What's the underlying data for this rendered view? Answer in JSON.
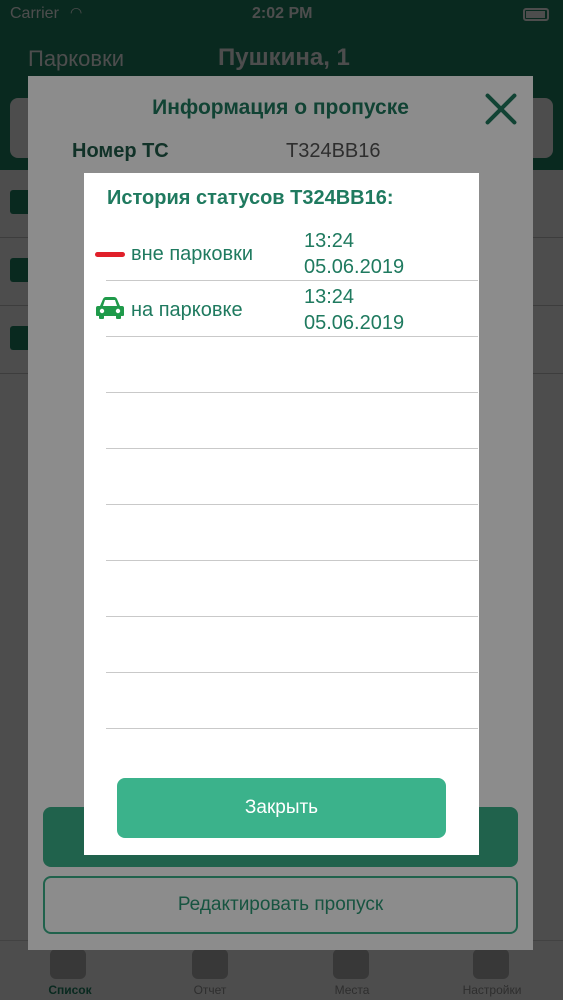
{
  "status_bar": {
    "carrier": "Carrier",
    "time": "2:02 PM"
  },
  "navbar": {
    "left_label": "Парковки",
    "title": "Пушкина, 1"
  },
  "tabbar": {
    "tabs": [
      {
        "label": "Список"
      },
      {
        "label": "Отчет"
      },
      {
        "label": "Места"
      },
      {
        "label": "Настройки"
      }
    ]
  },
  "info_modal": {
    "title": "Информация о пропуске",
    "rows": [
      {
        "label": "Номер ТС",
        "value": "Т324ВВ16"
      }
    ],
    "edit_button": "Редактировать пропуск"
  },
  "history": {
    "title": "История статусов Т324ВВ16:",
    "items": [
      {
        "status": "вне парковки",
        "time": "13:24",
        "date": "05.06.2019",
        "icon": "red-dash-icon",
        "icon_color": "#e0202a"
      },
      {
        "status": "на парковке",
        "time": "13:24",
        "date": "05.06.2019",
        "icon": "car-icon",
        "icon_color": "#1f9a4a"
      }
    ],
    "close_button": "Закрыть"
  },
  "colors": {
    "accent": "#1f8a6a",
    "button": "#3bb28b",
    "text_green": "#1f7a5f",
    "danger": "#e0202a"
  }
}
